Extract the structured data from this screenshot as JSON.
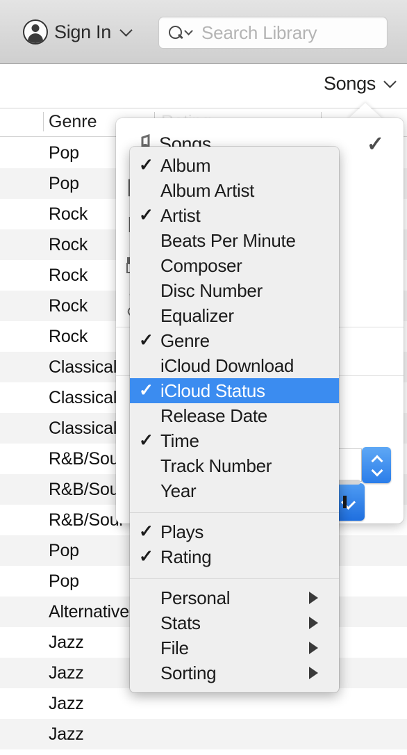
{
  "toolbar": {
    "signin_label": "Sign In",
    "signin_icon": "user-avatar-icon",
    "chevron_icon": "chevron-down-icon",
    "search_icon": "search-icon",
    "search_value": "",
    "search_placeholder": "Search Library"
  },
  "viewbar": {
    "view_label": "Songs",
    "chevron_icon": "chevron-down-icon"
  },
  "table": {
    "headers": [
      {
        "label": "Genre"
      },
      {
        "label": "Rating"
      }
    ],
    "rows": [
      {
        "genre": "Pop"
      },
      {
        "genre": "Pop"
      },
      {
        "genre": "Rock"
      },
      {
        "genre": "Rock"
      },
      {
        "genre": "Rock"
      },
      {
        "genre": "Rock"
      },
      {
        "genre": "Rock"
      },
      {
        "genre": "Classical"
      },
      {
        "genre": "Classical"
      },
      {
        "genre": "Classical"
      },
      {
        "genre": "R&B/Soul"
      },
      {
        "genre": "R&B/Soul"
      },
      {
        "genre": "R&B/Soul"
      },
      {
        "genre": "Pop"
      },
      {
        "genre": "Pop"
      },
      {
        "genre": "Alternative"
      },
      {
        "genre": "Jazz"
      },
      {
        "genre": "Jazz"
      },
      {
        "genre": "Jazz"
      },
      {
        "genre": "Jazz"
      }
    ]
  },
  "view_popover": {
    "items": [
      {
        "label": "Songs",
        "icon": "music-note-icon",
        "checked": true
      },
      {
        "label": "",
        "icon": "albums-icon",
        "checked": false
      },
      {
        "label": "",
        "icon": "artist-microphone-icon",
        "checked": false
      },
      {
        "label": "",
        "icon": "piano-keyboard-icon",
        "checked": false
      },
      {
        "label": "",
        "icon": "guitars-genre-icon",
        "checked": false
      }
    ],
    "check_glyph": "✓",
    "stepper_icon": "stepper-up-down-icon",
    "popup_button_icon": "chevron-down-icon",
    "slider_icon": "slider-track"
  },
  "columns_menu": {
    "group_main": [
      {
        "label": "Album",
        "checked": true
      },
      {
        "label": "Album Artist",
        "checked": false
      },
      {
        "label": "Artist",
        "checked": true
      },
      {
        "label": "Beats Per Minute",
        "checked": false
      },
      {
        "label": "Composer",
        "checked": false
      },
      {
        "label": "Disc Number",
        "checked": false
      },
      {
        "label": "Equalizer",
        "checked": false
      },
      {
        "label": "Genre",
        "checked": true
      },
      {
        "label": "iCloud Download",
        "checked": false
      },
      {
        "label": "iCloud Status",
        "checked": true,
        "selected": true
      },
      {
        "label": "Release Date",
        "checked": false
      },
      {
        "label": "Time",
        "checked": true
      },
      {
        "label": "Track Number",
        "checked": false
      },
      {
        "label": "Year",
        "checked": false
      }
    ],
    "group_stats": [
      {
        "label": "Plays",
        "checked": true
      },
      {
        "label": "Rating",
        "checked": true
      }
    ],
    "group_submenus": [
      {
        "label": "Personal",
        "submenu": true
      },
      {
        "label": "Stats",
        "submenu": true
      },
      {
        "label": "File",
        "submenu": true
      },
      {
        "label": "Sorting",
        "submenu": true
      }
    ],
    "check_glyph": "✓",
    "submenu_arrow_icon": "triangle-right-icon"
  },
  "colors": {
    "selection_blue": "#3b8cf0",
    "menu_background": "#efefef",
    "row_stripe": "#f3f3f3",
    "toolbar_gray": "#d8d8d8"
  }
}
